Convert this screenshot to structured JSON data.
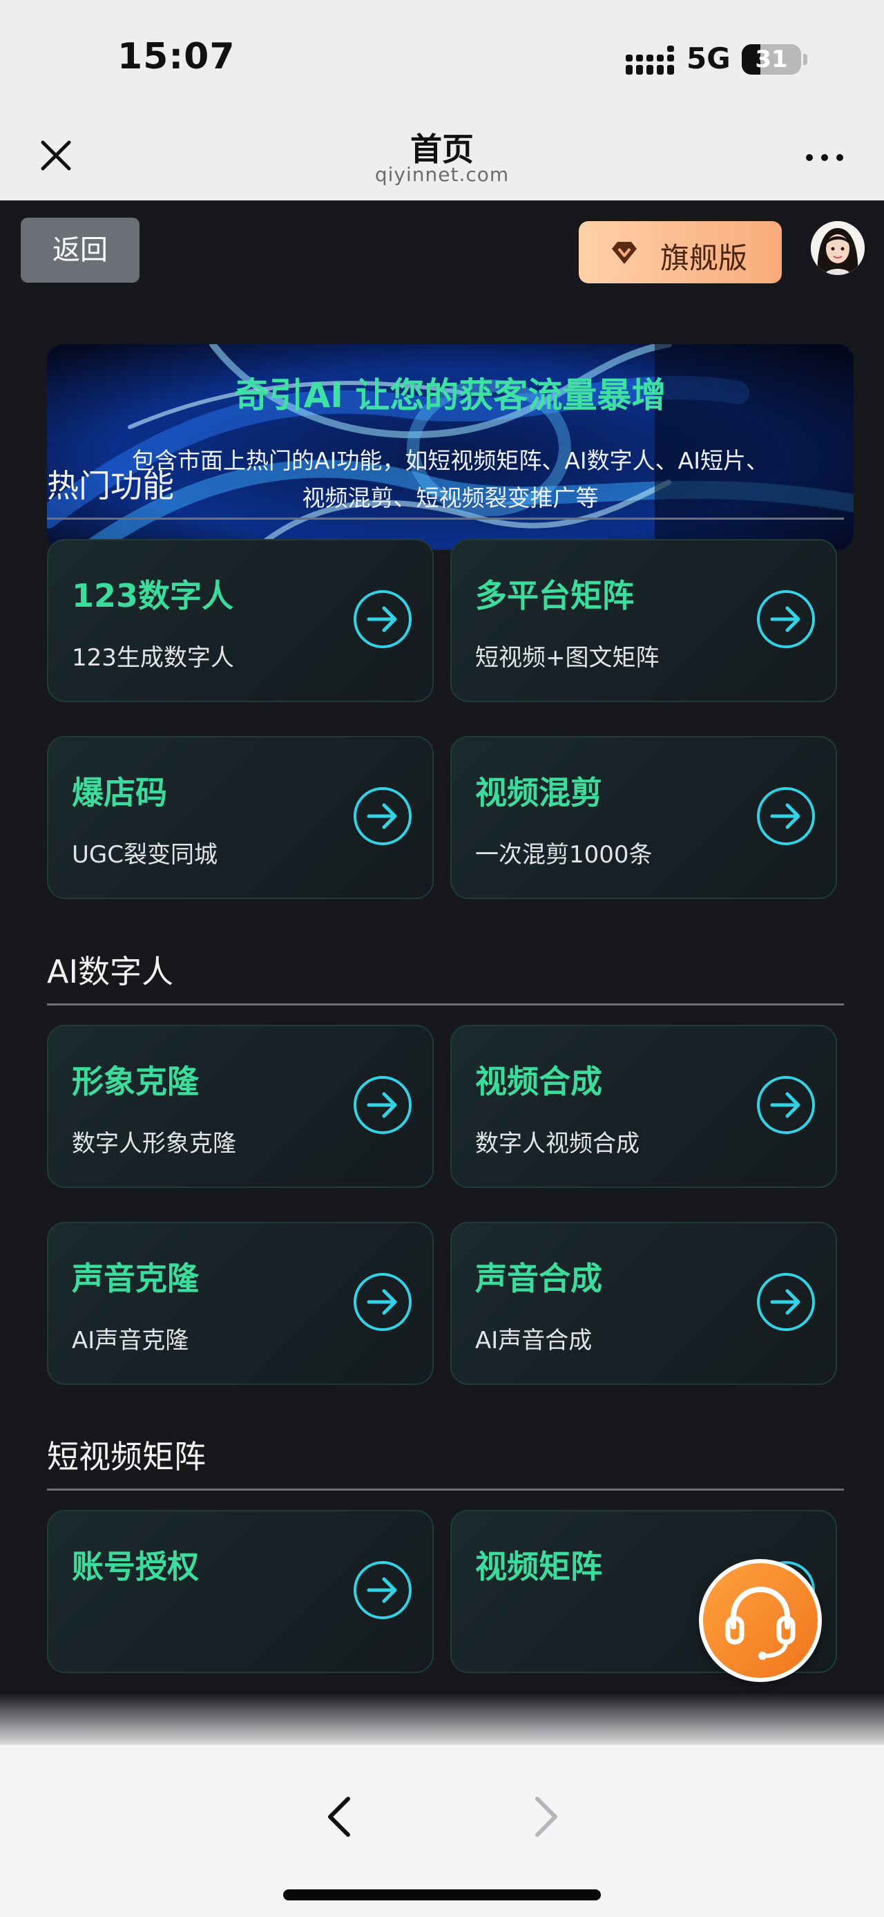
{
  "status_bar": {
    "time": "15:07",
    "network": "5G",
    "battery": "31",
    "battery_level": 0.31
  },
  "browser": {
    "title": "首页",
    "url": "qiyinnet.com"
  },
  "header": {
    "back_label": "返回",
    "flagship_label": "旗舰版"
  },
  "banner": {
    "title": "奇引AI 让您的获客流量暴增",
    "description": "包含市面上热门的AI功能，如短视频矩阵、AI数字人、AI短片、视频混剪、短视频裂变推广等"
  },
  "sections": [
    {
      "title": "热门功能",
      "cards": [
        {
          "title": "123数字人",
          "subtitle": "123生成数字人"
        },
        {
          "title": "多平台矩阵",
          "subtitle": "短视频+图文矩阵"
        },
        {
          "title": "爆店码",
          "subtitle": "UGC裂变同城"
        },
        {
          "title": "视频混剪",
          "subtitle": "一次混剪1000条"
        }
      ]
    },
    {
      "title": "AI数字人",
      "cards": [
        {
          "title": "形象克隆",
          "subtitle": "数字人形象克隆"
        },
        {
          "title": "视频合成",
          "subtitle": "数字人视频合成"
        },
        {
          "title": "声音克隆",
          "subtitle": "AI声音克隆"
        },
        {
          "title": "声音合成",
          "subtitle": "AI声音合成"
        }
      ]
    },
    {
      "title": "短视频矩阵",
      "cards": [
        {
          "title": "账号授权",
          "subtitle": ""
        },
        {
          "title": "视频矩阵",
          "subtitle": ""
        }
      ]
    }
  ],
  "colors": {
    "accent": "#3cdc9c",
    "background": "#17181c",
    "flagship": "#f8ab7b",
    "support": "#f7922f"
  },
  "icons": {
    "close": "close-icon",
    "more": "more-icon",
    "flagship": "diamond-icon",
    "card_arrow": "arrow-right-circle-icon",
    "support": "headset-icon",
    "toolbar_back": "chevron-left-icon",
    "toolbar_forward": "chevron-right-icon"
  }
}
